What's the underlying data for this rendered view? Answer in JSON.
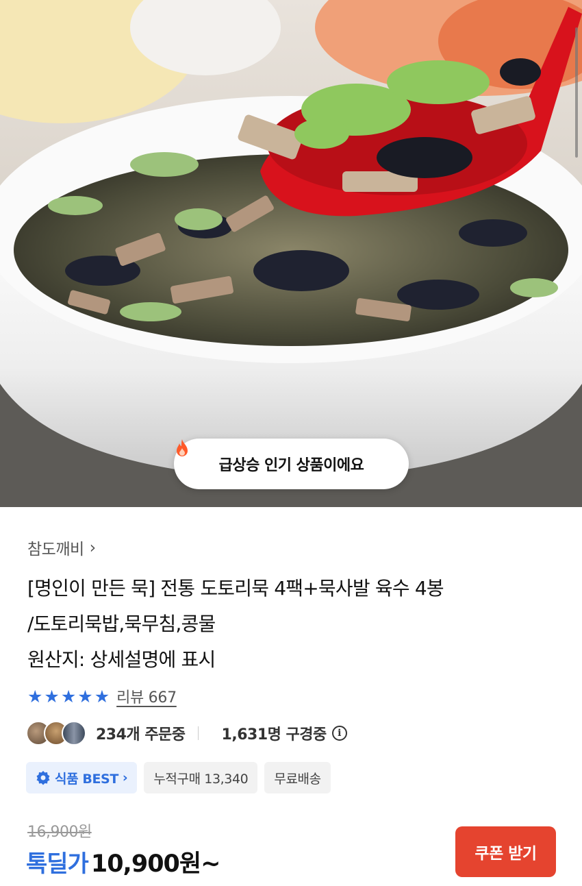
{
  "hero": {
    "popular_badge": "급상승 인기 상품이에요"
  },
  "product": {
    "seller": "참도깨비",
    "title_lines": [
      "[명인이 만든 묵] 전통 도토리묵 4팩+묵사발 육수 4봉",
      "/도토리묵밥,묵무침,콩물",
      "원산지: 상세설명에 표시"
    ],
    "rating": {
      "stars": 5,
      "review_label": "리뷰 667"
    },
    "orders": {
      "ordering": "234개 주문중",
      "viewing": "1,631명 구경중"
    },
    "tags": {
      "best": "식품 BEST",
      "cumulative": "누적구매 13,340",
      "shipping": "무료배송"
    },
    "price": {
      "original": "16,900원",
      "sale_label": "톡딜가",
      "sale_price": "10,900원~"
    },
    "coupon_button": "쿠폰 받기"
  },
  "colors": {
    "accent_blue": "#2f6fde",
    "coupon_red": "#e5442f",
    "fire_orange": "#ff5a2a"
  }
}
